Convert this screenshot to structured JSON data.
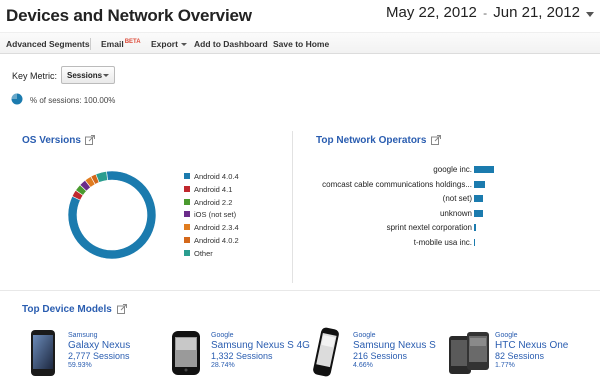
{
  "header": {
    "title": "Devices and Network Overview",
    "date_start": "May 22, 2012",
    "date_separator": "-",
    "date_end": "Jun 21, 2012"
  },
  "toolbar": {
    "advanced_segments": "Advanced Segments",
    "email": "Email",
    "email_badge": "BETA",
    "export": "Export",
    "add_to_dashboard": "Add to Dashboard",
    "save_to_home": "Save to Home"
  },
  "key_metric": {
    "label": "Key Metric:",
    "value": "Sessions"
  },
  "summary": {
    "text": "% of sessions: 100.00%",
    "value": 1.0
  },
  "os_versions": {
    "title": "OS Versions",
    "icon": "external-link-icon",
    "chart_data": {
      "type": "pie",
      "style": "donut",
      "categories": [
        "Android 4.0.4",
        "Android 4.1",
        "Android 2.2",
        "iOS (not set)",
        "Android 2.3.4",
        "Android 4.0.2",
        "Other"
      ],
      "values": [
        84,
        2.5,
        2.5,
        2.5,
        2.5,
        2,
        4
      ],
      "colors": [
        "#1b7bae",
        "#c0282e",
        "#4a9a2f",
        "#6b2c8a",
        "#e07c1f",
        "#d4681a",
        "#2a9d8f"
      ],
      "legend_position": "right"
    }
  },
  "network_operators": {
    "title": "Top Network Operators",
    "icon": "external-link-icon",
    "chart_data": {
      "type": "bar",
      "orientation": "horizontal",
      "categories": [
        "google inc.",
        "comcast cable communications holdings...",
        "(not set)",
        "unknown",
        "sprint nextel corporation",
        "t-mobile usa inc."
      ],
      "values": [
        20,
        11,
        9,
        9,
        1.5,
        0.5
      ],
      "color": "#1b7bae"
    }
  },
  "top_devices": {
    "title": "Top Device Models",
    "icon": "external-link-icon",
    "items": [
      {
        "brand": "Samsung",
        "name": "Galaxy Nexus",
        "sessions": "2,777 Sessions",
        "pct": "59.93%"
      },
      {
        "brand": "Google",
        "name": "Samsung Nexus S 4G",
        "sessions": "1,332 Sessions",
        "pct": "28.74%"
      },
      {
        "brand": "Google",
        "name": "Samsung Nexus S",
        "sessions": "216 Sessions",
        "pct": "4.66%"
      },
      {
        "brand": "Google",
        "name": "HTC Nexus One",
        "sessions": "82 Sessions",
        "pct": "1.77%"
      }
    ]
  }
}
